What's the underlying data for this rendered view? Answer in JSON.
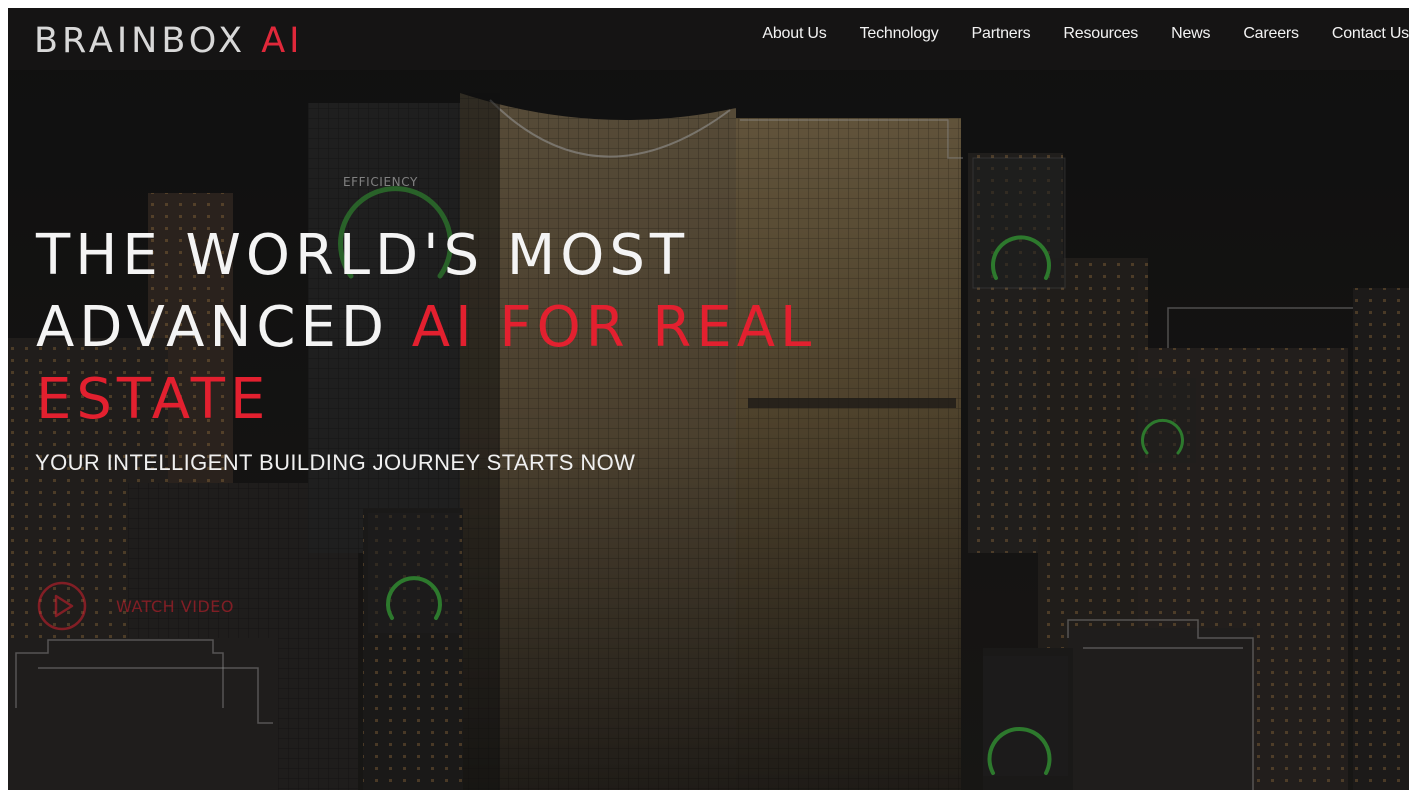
{
  "brand": {
    "name_main": "BRAINBOX",
    "name_accent": "AI"
  },
  "nav": {
    "items": [
      {
        "label": "About Us"
      },
      {
        "label": "Technology"
      },
      {
        "label": "Partners"
      },
      {
        "label": "Resources"
      },
      {
        "label": "News"
      },
      {
        "label": "Careers"
      },
      {
        "label": "Contact Us"
      }
    ]
  },
  "hero": {
    "headline_line1": "THE WORLD'S MOST",
    "headline_line2_white": "ADVANCED ",
    "headline_line2_red": "AI FOR REAL",
    "headline_line3_red": "ESTATE",
    "subheadline": "YOUR INTELLIGENT BUILDING JOURNEY STARTS NOW",
    "watch_video_label": "WATCH VIDEO"
  },
  "overlay_panels": {
    "main_label": "EFFICIENCY"
  },
  "colors": {
    "accent_red": "#e3202f",
    "gauge_green": "#3fae3f",
    "nav_bg": "#161514"
  },
  "icons": {
    "play": "play-icon",
    "efficiency_gauge": "gauge-icon"
  }
}
